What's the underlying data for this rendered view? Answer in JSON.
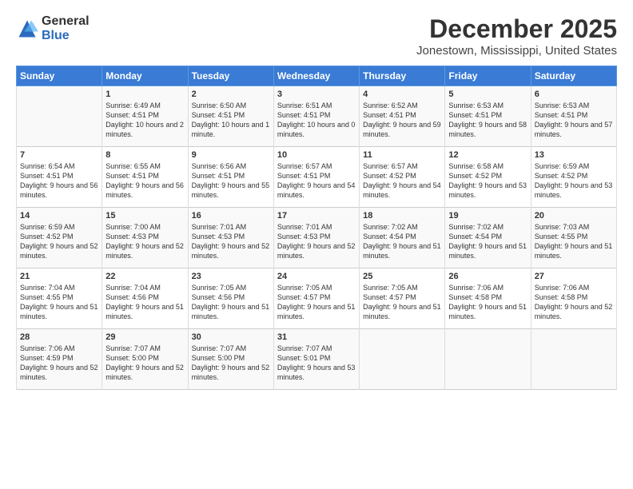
{
  "logo": {
    "general": "General",
    "blue": "Blue"
  },
  "title": "December 2025",
  "location": "Jonestown, Mississippi, United States",
  "days_header": [
    "Sunday",
    "Monday",
    "Tuesday",
    "Wednesday",
    "Thursday",
    "Friday",
    "Saturday"
  ],
  "weeks": [
    [
      {
        "num": "",
        "sunrise": "",
        "sunset": "",
        "daylight": ""
      },
      {
        "num": "1",
        "sunrise": "Sunrise: 6:49 AM",
        "sunset": "Sunset: 4:51 PM",
        "daylight": "Daylight: 10 hours and 2 minutes."
      },
      {
        "num": "2",
        "sunrise": "Sunrise: 6:50 AM",
        "sunset": "Sunset: 4:51 PM",
        "daylight": "Daylight: 10 hours and 1 minute."
      },
      {
        "num": "3",
        "sunrise": "Sunrise: 6:51 AM",
        "sunset": "Sunset: 4:51 PM",
        "daylight": "Daylight: 10 hours and 0 minutes."
      },
      {
        "num": "4",
        "sunrise": "Sunrise: 6:52 AM",
        "sunset": "Sunset: 4:51 PM",
        "daylight": "Daylight: 9 hours and 59 minutes."
      },
      {
        "num": "5",
        "sunrise": "Sunrise: 6:53 AM",
        "sunset": "Sunset: 4:51 PM",
        "daylight": "Daylight: 9 hours and 58 minutes."
      },
      {
        "num": "6",
        "sunrise": "Sunrise: 6:53 AM",
        "sunset": "Sunset: 4:51 PM",
        "daylight": "Daylight: 9 hours and 57 minutes."
      }
    ],
    [
      {
        "num": "7",
        "sunrise": "Sunrise: 6:54 AM",
        "sunset": "Sunset: 4:51 PM",
        "daylight": "Daylight: 9 hours and 56 minutes."
      },
      {
        "num": "8",
        "sunrise": "Sunrise: 6:55 AM",
        "sunset": "Sunset: 4:51 PM",
        "daylight": "Daylight: 9 hours and 56 minutes."
      },
      {
        "num": "9",
        "sunrise": "Sunrise: 6:56 AM",
        "sunset": "Sunset: 4:51 PM",
        "daylight": "Daylight: 9 hours and 55 minutes."
      },
      {
        "num": "10",
        "sunrise": "Sunrise: 6:57 AM",
        "sunset": "Sunset: 4:51 PM",
        "daylight": "Daylight: 9 hours and 54 minutes."
      },
      {
        "num": "11",
        "sunrise": "Sunrise: 6:57 AM",
        "sunset": "Sunset: 4:52 PM",
        "daylight": "Daylight: 9 hours and 54 minutes."
      },
      {
        "num": "12",
        "sunrise": "Sunrise: 6:58 AM",
        "sunset": "Sunset: 4:52 PM",
        "daylight": "Daylight: 9 hours and 53 minutes."
      },
      {
        "num": "13",
        "sunrise": "Sunrise: 6:59 AM",
        "sunset": "Sunset: 4:52 PM",
        "daylight": "Daylight: 9 hours and 53 minutes."
      }
    ],
    [
      {
        "num": "14",
        "sunrise": "Sunrise: 6:59 AM",
        "sunset": "Sunset: 4:52 PM",
        "daylight": "Daylight: 9 hours and 52 minutes."
      },
      {
        "num": "15",
        "sunrise": "Sunrise: 7:00 AM",
        "sunset": "Sunset: 4:53 PM",
        "daylight": "Daylight: 9 hours and 52 minutes."
      },
      {
        "num": "16",
        "sunrise": "Sunrise: 7:01 AM",
        "sunset": "Sunset: 4:53 PM",
        "daylight": "Daylight: 9 hours and 52 minutes."
      },
      {
        "num": "17",
        "sunrise": "Sunrise: 7:01 AM",
        "sunset": "Sunset: 4:53 PM",
        "daylight": "Daylight: 9 hours and 52 minutes."
      },
      {
        "num": "18",
        "sunrise": "Sunrise: 7:02 AM",
        "sunset": "Sunset: 4:54 PM",
        "daylight": "Daylight: 9 hours and 51 minutes."
      },
      {
        "num": "19",
        "sunrise": "Sunrise: 7:02 AM",
        "sunset": "Sunset: 4:54 PM",
        "daylight": "Daylight: 9 hours and 51 minutes."
      },
      {
        "num": "20",
        "sunrise": "Sunrise: 7:03 AM",
        "sunset": "Sunset: 4:55 PM",
        "daylight": "Daylight: 9 hours and 51 minutes."
      }
    ],
    [
      {
        "num": "21",
        "sunrise": "Sunrise: 7:04 AM",
        "sunset": "Sunset: 4:55 PM",
        "daylight": "Daylight: 9 hours and 51 minutes."
      },
      {
        "num": "22",
        "sunrise": "Sunrise: 7:04 AM",
        "sunset": "Sunset: 4:56 PM",
        "daylight": "Daylight: 9 hours and 51 minutes."
      },
      {
        "num": "23",
        "sunrise": "Sunrise: 7:05 AM",
        "sunset": "Sunset: 4:56 PM",
        "daylight": "Daylight: 9 hours and 51 minutes."
      },
      {
        "num": "24",
        "sunrise": "Sunrise: 7:05 AM",
        "sunset": "Sunset: 4:57 PM",
        "daylight": "Daylight: 9 hours and 51 minutes."
      },
      {
        "num": "25",
        "sunrise": "Sunrise: 7:05 AM",
        "sunset": "Sunset: 4:57 PM",
        "daylight": "Daylight: 9 hours and 51 minutes."
      },
      {
        "num": "26",
        "sunrise": "Sunrise: 7:06 AM",
        "sunset": "Sunset: 4:58 PM",
        "daylight": "Daylight: 9 hours and 51 minutes."
      },
      {
        "num": "27",
        "sunrise": "Sunrise: 7:06 AM",
        "sunset": "Sunset: 4:58 PM",
        "daylight": "Daylight: 9 hours and 52 minutes."
      }
    ],
    [
      {
        "num": "28",
        "sunrise": "Sunrise: 7:06 AM",
        "sunset": "Sunset: 4:59 PM",
        "daylight": "Daylight: 9 hours and 52 minutes."
      },
      {
        "num": "29",
        "sunrise": "Sunrise: 7:07 AM",
        "sunset": "Sunset: 5:00 PM",
        "daylight": "Daylight: 9 hours and 52 minutes."
      },
      {
        "num": "30",
        "sunrise": "Sunrise: 7:07 AM",
        "sunset": "Sunset: 5:00 PM",
        "daylight": "Daylight: 9 hours and 52 minutes."
      },
      {
        "num": "31",
        "sunrise": "Sunrise: 7:07 AM",
        "sunset": "Sunset: 5:01 PM",
        "daylight": "Daylight: 9 hours and 53 minutes."
      },
      {
        "num": "",
        "sunrise": "",
        "sunset": "",
        "daylight": ""
      },
      {
        "num": "",
        "sunrise": "",
        "sunset": "",
        "daylight": ""
      },
      {
        "num": "",
        "sunrise": "",
        "sunset": "",
        "daylight": ""
      }
    ]
  ]
}
